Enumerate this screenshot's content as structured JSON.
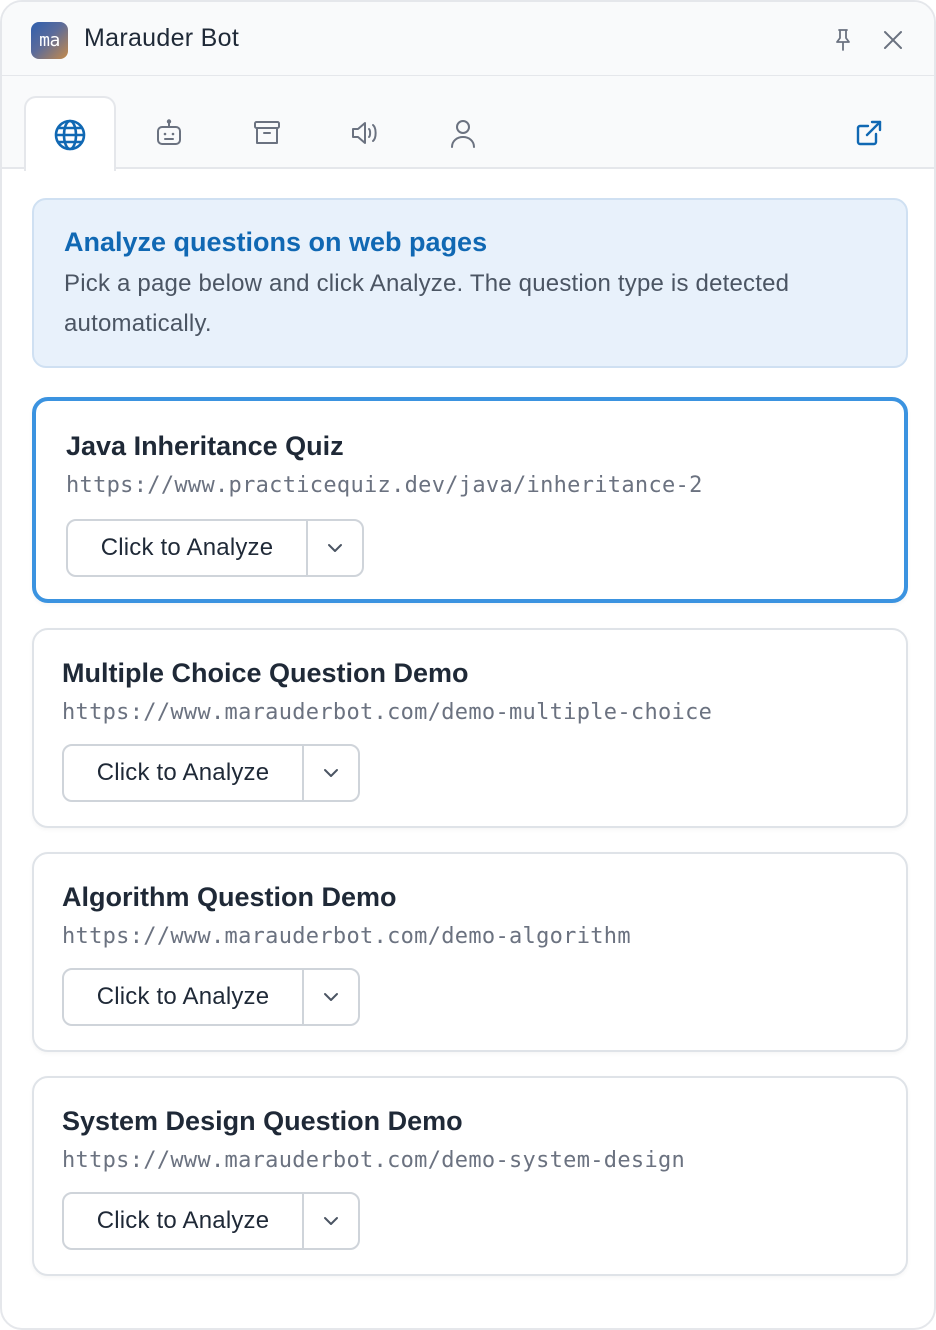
{
  "app": {
    "logo_text": "ma",
    "title": "Marauder Bot"
  },
  "tabs": [
    {
      "icon": "globe-icon",
      "active": true
    },
    {
      "icon": "robot-icon",
      "active": false
    },
    {
      "icon": "archive-icon",
      "active": false
    },
    {
      "icon": "speaker-icon",
      "active": false
    },
    {
      "icon": "user-icon",
      "active": false
    }
  ],
  "banner": {
    "title": "Analyze questions on web pages",
    "text": "Pick a page below and click Analyze. The question type is detected automatically."
  },
  "pages": [
    {
      "title": "Java Inheritance Quiz",
      "url": "https://www.practicequiz.dev/java/inheritance-2",
      "button": "Click to Analyze",
      "selected": true
    },
    {
      "title": "Multiple Choice Question Demo",
      "url": "https://www.marauderbot.com/demo-multiple-choice",
      "button": "Click to Analyze",
      "selected": false
    },
    {
      "title": "Algorithm Question Demo",
      "url": "https://www.marauderbot.com/demo-algorithm",
      "button": "Click to Analyze",
      "selected": false
    },
    {
      "title": "System Design Question Demo",
      "url": "https://www.marauderbot.com/demo-system-design",
      "button": "Click to Analyze",
      "selected": false
    }
  ],
  "colors": {
    "accent": "#1068b3",
    "selected_border": "#3b93e0",
    "banner_bg": "#e8f1fb"
  }
}
